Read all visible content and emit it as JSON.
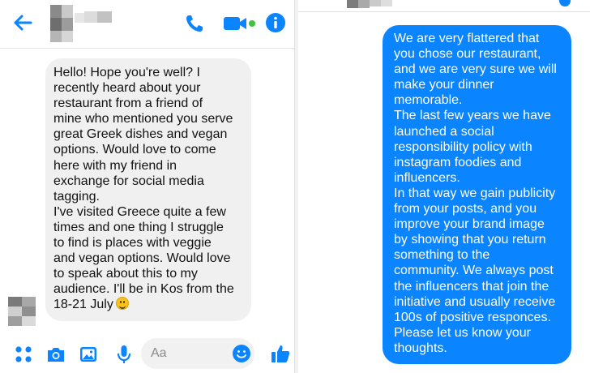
{
  "colors": {
    "accent": "#0a84ff",
    "incoming_bubble": "#f1f0f0",
    "outgoing_text": "#ffffff",
    "online_dot": "#3ec240"
  },
  "icons": {
    "back": "back-arrow-icon",
    "call": "phone-icon",
    "video": "video-camera-icon",
    "info": "info-icon",
    "apps": "apps-grid-icon",
    "camera": "camera-icon",
    "photo": "photo-icon",
    "mic": "microphone-icon",
    "emoji": "emoji-icon",
    "like": "thumbs-up-icon"
  },
  "left_chat": {
    "incoming_message": "Hello! Hope you're well? I\nrecently heard about your\nrestaurant from a friend of\nmine who mentioned you serve\ngreat Greek dishes and vegan\noptions. Would love to come\nhere with my friend in\nexchange for social media\ntagging.\nI've visited Greece quite a few\ntimes and one thing I struggle\nto find is places with veggie\nand vegan options. Would love\nto speak about this to my\naudience. I'll be in Kos from the\n18-21 July"
  },
  "composer": {
    "placeholder": "Aa"
  },
  "right_chat": {
    "outgoing_message": "We are very flattered that\nyou chose our restaurant,\nand we are very sure we will\nmake your dinner\nmemorable.\nThe last few years we have\nlaunched a social\nresponsibility policy with\ninstagram foodies and\ninfluencers.\nIn that way we gain publicity\nfrom your posts, and you\nimprove your brand image\nby showing that you return\nsomething to the\ncommunity. We always post\nthe influencers that join the\ninitiative and usually receive\n100s of positive responces.\nPlease let us know your\nthoughts."
  }
}
